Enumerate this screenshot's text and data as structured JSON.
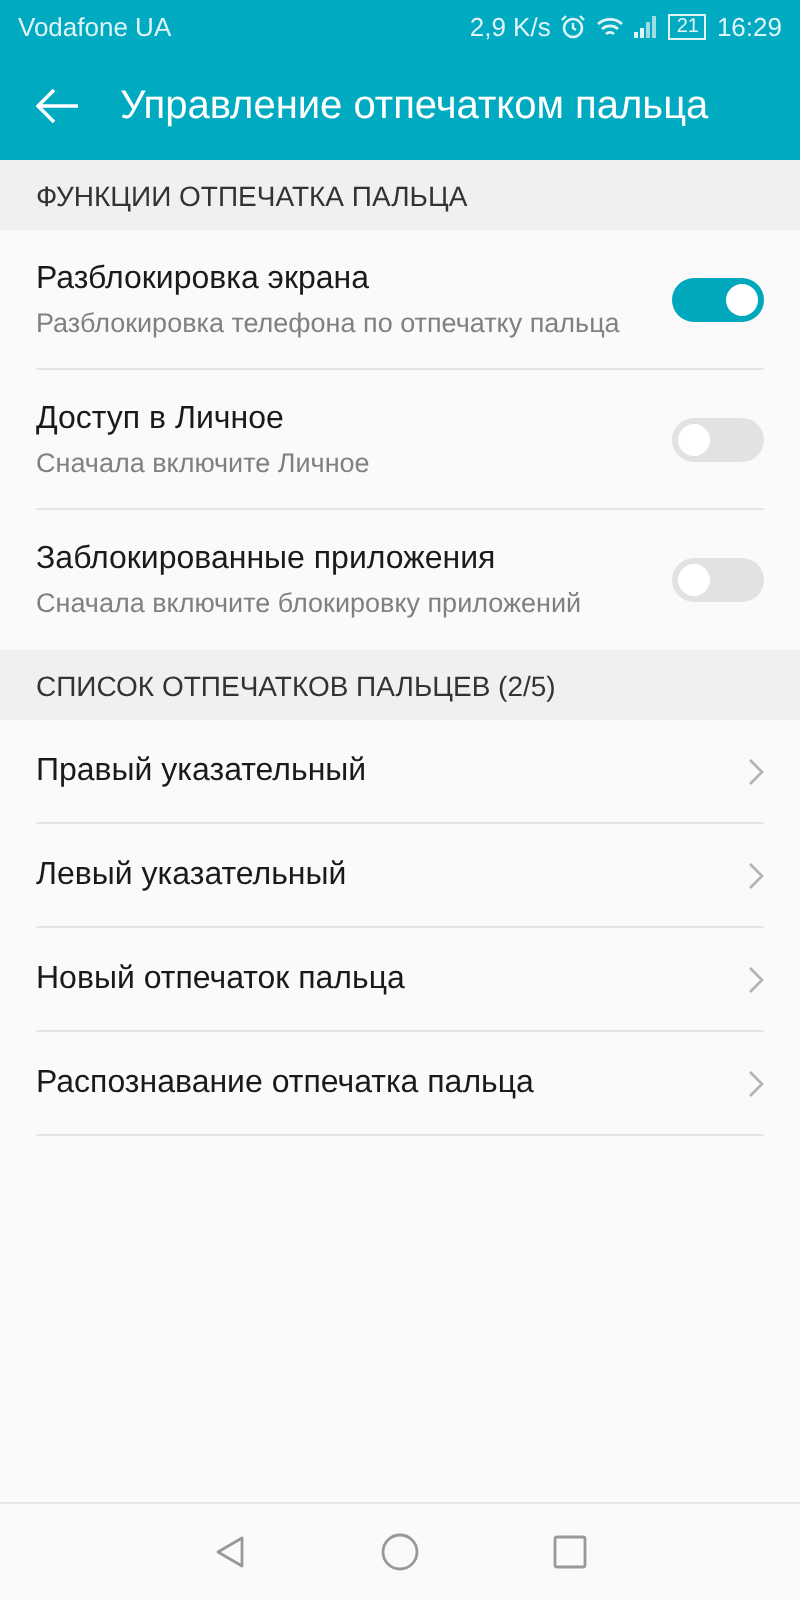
{
  "status_bar": {
    "carrier": "Vodafone UA",
    "speed": "2,9 K/s",
    "battery": "21",
    "time": "16:29"
  },
  "app_bar": {
    "title": "Управление отпечатком пальца"
  },
  "sections": [
    {
      "header": "ФУНКЦИИ ОТПЕЧАТКА ПАЛЬЦА",
      "items": [
        {
          "kind": "toggle",
          "title": "Разблокировка экрана",
          "subtitle": "Разблокировка телефона по отпечатку пальца",
          "on": true
        },
        {
          "kind": "toggle",
          "title": "Доступ в Личное",
          "subtitle": "Сначала включите Личное",
          "on": false
        },
        {
          "kind": "toggle",
          "title": "Заблокированные приложения",
          "subtitle": "Сначала включите блокировку приложений",
          "on": false
        }
      ]
    },
    {
      "header": "СПИСОК ОТПЕЧАТКОВ ПАЛЬЦЕВ (2/5)",
      "items": [
        {
          "kind": "link",
          "title": "Правый указательный"
        },
        {
          "kind": "link",
          "title": "Левый указательный"
        },
        {
          "kind": "link",
          "title": "Новый отпечаток пальца"
        },
        {
          "kind": "link",
          "title": "Распознавание отпечатка пальца"
        }
      ]
    }
  ]
}
